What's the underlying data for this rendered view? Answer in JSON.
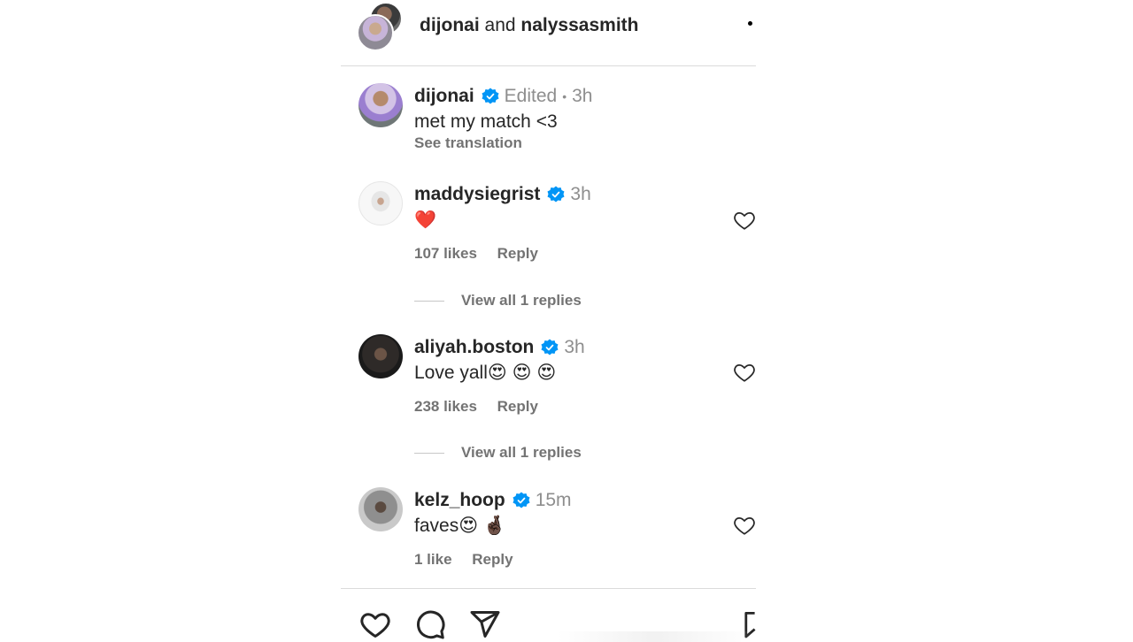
{
  "header": {
    "user1": "dijonai",
    "connector": "and",
    "user2": "nalyssasmith"
  },
  "caption": {
    "username": "dijonai",
    "edited": "Edited",
    "separator": "•",
    "time": "3h",
    "text": "met my match <3",
    "see_translation": "See translation"
  },
  "comments": [
    {
      "username": "maddysiegrist",
      "time": "3h",
      "text": "❤️",
      "likes": "107 likes",
      "reply": "Reply",
      "view_replies": "View all 1 replies"
    },
    {
      "username": "aliyah.boston",
      "time": "3h",
      "text": "Love yall😍 😍 😍",
      "likes": "238 likes",
      "reply": "Reply",
      "view_replies": "View all 1 replies"
    },
    {
      "username": "kelz_hoop",
      "time": "15m",
      "text": "faves😍 🤞🏿",
      "likes": "1 like",
      "reply": "Reply"
    }
  ],
  "colors": {
    "verified": "#0095f6",
    "text": "#262626",
    "muted": "#8e8e8e",
    "divider": "#dbdbdb"
  }
}
